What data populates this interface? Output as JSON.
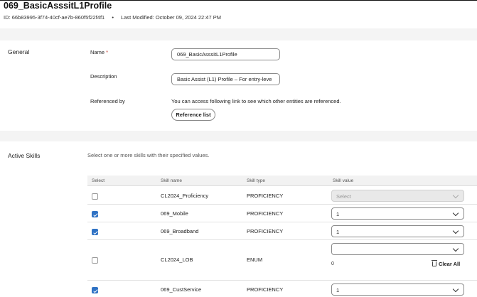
{
  "header": {
    "title": "069_BasicAsssitL1Profile",
    "id_label": "ID:",
    "id_value": "66b83995-3f74-40cf-ae7b-860f5f22f4f1",
    "separator": "•",
    "modified_label": "Last Modified:",
    "modified_value": "October 09, 2024 22:47 PM"
  },
  "general": {
    "section_label": "General",
    "name_label": "Name",
    "required_marker": "*",
    "name_value": "069_BasicAsssitL1Profile",
    "description_label": "Description",
    "description_value": "Basic Assist (L1) Profile – For entry-leve",
    "referenced_by_label": "Referenced by",
    "referenced_text": "You can access following link to see which other entities are referenced.",
    "reference_button": "Reference list"
  },
  "skills": {
    "section_label": "Active Skills",
    "hint": "Select one or more skills with their specified values.",
    "columns": [
      "Select",
      "Skill name",
      "Skill type",
      "Skill value"
    ],
    "rows": [
      {
        "selected": false,
        "name": "CL2024_Proficiency",
        "type": "PROFICIENCY",
        "value": "Select",
        "disabled": true
      },
      {
        "selected": true,
        "name": "069_Mobile",
        "type": "PROFICIENCY",
        "value": "1",
        "disabled": false
      },
      {
        "selected": true,
        "name": "069_Broadband",
        "type": "PROFICIENCY",
        "value": "1",
        "disabled": false
      },
      {
        "selected": false,
        "name": "CL2024_LOB",
        "type": "ENUM",
        "value": "",
        "disabled": false,
        "count": "0",
        "clear_label": "Clear All"
      },
      {
        "selected": true,
        "name": "069_CustService",
        "type": "PROFICIENCY",
        "value": "1",
        "disabled": false
      }
    ]
  }
}
